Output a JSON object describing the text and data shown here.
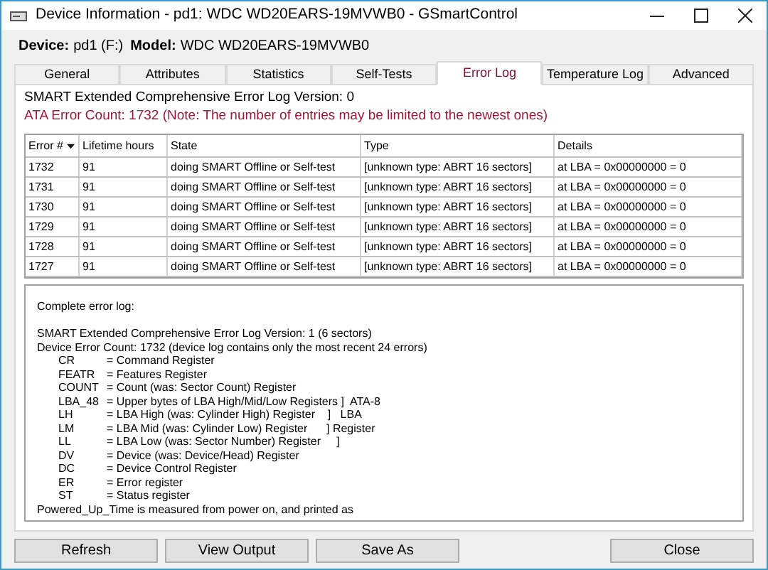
{
  "window": {
    "title": "Device Information - pd1: WDC WD20EARS-19MVWB0 - GSmartControl"
  },
  "device_line": {
    "device_label": "Device:",
    "device": "pd1 (F:)",
    "model_label": "Model:",
    "model": "WDC WD20EARS-19MVWB0"
  },
  "tabs": [
    {
      "label": "General",
      "selected": false
    },
    {
      "label": "Attributes",
      "selected": false
    },
    {
      "label": "Statistics",
      "selected": false
    },
    {
      "label": "Self-Tests",
      "selected": false
    },
    {
      "label": "Error Log",
      "selected": true
    },
    {
      "label": "Temperature Log",
      "selected": false
    },
    {
      "label": "Advanced",
      "selected": false
    }
  ],
  "info": [
    {
      "text": "SMART Extended Comprehensive Error Log Version: 0",
      "kind": "normal"
    },
    {
      "text": "ATA Error Count: 1732 (Note: The number of entries may be limited to the newest ones)",
      "kind": "warning"
    }
  ],
  "table": {
    "columns": [
      {
        "label": "Error #",
        "sorted": true
      },
      {
        "label": "Lifetime hours",
        "sorted": false
      },
      {
        "label": "State",
        "sorted": false
      },
      {
        "label": "Type",
        "sorted": false
      },
      {
        "label": "Details",
        "sorted": false
      }
    ],
    "rows": [
      [
        "1732",
        "91",
        "doing SMART Offline or Self-test",
        "[unknown type: ABRT 16 sectors]",
        "at LBA = 0x00000000 = 0"
      ],
      [
        "1731",
        "91",
        "doing SMART Offline or Self-test",
        "[unknown type: ABRT 16 sectors]",
        "at LBA = 0x00000000 = 0"
      ],
      [
        "1730",
        "91",
        "doing SMART Offline or Self-test",
        "[unknown type: ABRT 16 sectors]",
        "at LBA = 0x00000000 = 0"
      ],
      [
        "1729",
        "91",
        "doing SMART Offline or Self-test",
        "[unknown type: ABRT 16 sectors]",
        "at LBA = 0x00000000 = 0"
      ],
      [
        "1728",
        "91",
        "doing SMART Offline or Self-test",
        "[unknown type: ABRT 16 sectors]",
        "at LBA = 0x00000000 = 0"
      ],
      [
        "1727",
        "91",
        "doing SMART Offline or Self-test",
        "[unknown type: ABRT 16 sectors]",
        "at LBA = 0x00000000 = 0"
      ]
    ]
  },
  "log": [
    {
      "kind": "line",
      "text": "Complete error log:"
    },
    {
      "kind": "gap"
    },
    {
      "kind": "line",
      "text": "SMART Extended Comprehensive Error Log Version: 1 (6 sectors)"
    },
    {
      "kind": "line",
      "text": "Device Error Count: 1732 (device log contains only the most recent 24 errors)"
    },
    {
      "kind": "register",
      "code": "CR",
      "text": "= Command Register"
    },
    {
      "kind": "register",
      "code": "FEATR",
      "text": "= Features Register"
    },
    {
      "kind": "register",
      "code": "COUNT",
      "text": "= Count (was: Sector Count) Register"
    },
    {
      "kind": "register",
      "code": "LBA_48",
      "text": "= Upper bytes of LBA High/Mid/Low Registers ]  ATA-8"
    },
    {
      "kind": "register",
      "code": "LH",
      "text": "= LBA High (was: Cylinder High) Register    ]   LBA"
    },
    {
      "kind": "register",
      "code": "LM",
      "text": "= LBA Mid (was: Cylinder Low) Register      ] Register"
    },
    {
      "kind": "register",
      "code": "LL",
      "text": "= LBA Low (was: Sector Number) Register     ]"
    },
    {
      "kind": "register",
      "code": "DV",
      "text": "= Device (was: Device/Head) Register"
    },
    {
      "kind": "register",
      "code": "DC",
      "text": "= Device Control Register"
    },
    {
      "kind": "register",
      "code": "ER",
      "text": "= Error register"
    },
    {
      "kind": "register",
      "code": "ST",
      "text": "= Status register"
    },
    {
      "kind": "line",
      "text": "Powered_Up_Time is measured from power on, and printed as"
    }
  ],
  "buttons": [
    {
      "label": "Refresh"
    },
    {
      "label": "View Output"
    },
    {
      "label": "Save As"
    },
    {
      "label": "Close"
    }
  ]
}
